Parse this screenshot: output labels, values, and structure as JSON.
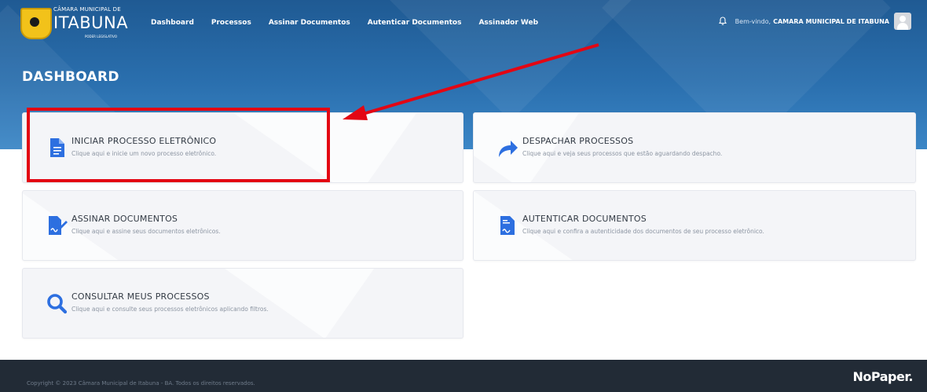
{
  "brand": {
    "line1": "CÂMARA MUNICIPAL DE",
    "line2": "ITABUNA",
    "line3": "PODER LEGISLATIVO"
  },
  "nav": {
    "items": [
      {
        "label": "Dashboard"
      },
      {
        "label": "Processos"
      },
      {
        "label": "Assinar Documentos"
      },
      {
        "label": "Autenticar Documentos"
      },
      {
        "label": "Assinador Web"
      }
    ]
  },
  "user": {
    "welcome": "Bem-vindo,",
    "name": "CAMARA MUNICIPAL DE ITABUNA"
  },
  "page": {
    "title": "DASHBOARD"
  },
  "cards": [
    {
      "title": "INICIAR PROCESSO ELETRÔNICO",
      "desc": "Clique aqui e inicie um novo processo eletrônico.",
      "icon": "document-icon"
    },
    {
      "title": "DESPACHAR PROCESSOS",
      "desc": "Clique aqui e veja seus processos que estão aguardando despacho.",
      "icon": "share-arrow-icon"
    },
    {
      "title": "ASSINAR DOCUMENTOS",
      "desc": "Clique aqui e assine seus documentos eletrônicos.",
      "icon": "sign-document-icon"
    },
    {
      "title": "AUTENTICAR DOCUMENTOS",
      "desc": "Clique aqui e confira a autenticidade dos documentos de seu processo eletrônico.",
      "icon": "authenticate-document-icon"
    },
    {
      "title": "CONSULTAR MEUS PROCESSOS",
      "desc": "Clique aqui e consulte seus processos eletrônicos aplicando filtros.",
      "icon": "search-icon"
    }
  ],
  "footer": {
    "copyright": "Copyright © 2023 Câmara Municipal de Itabuna - BA. Todos os direitos reservados.",
    "logo": "NoPaper."
  },
  "colors": {
    "header": "#2a6fae",
    "accent_icon": "#2d6fe0",
    "annotation": "#e30613",
    "footer": "#222b36"
  }
}
